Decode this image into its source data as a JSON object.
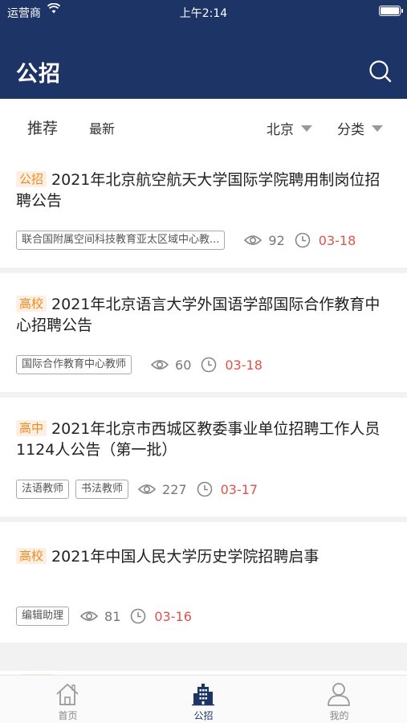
{
  "status_bar": {
    "carrier": "运营商",
    "time": "上午2:14"
  },
  "header": {
    "title": "公招",
    "search_icon": "search-icon"
  },
  "filter": {
    "tabs": [
      {
        "label": "推荐",
        "active": true
      },
      {
        "label": "最新",
        "active": false
      }
    ],
    "region": "北京",
    "category": "分类"
  },
  "cards": [
    {
      "badge": "公招",
      "title": "2021年北京航空航天大学国际学院聘用制岗位招聘公告",
      "tags": [
        "联合国附属空间科技教育亚太区域中心教..."
      ],
      "views": "92",
      "date": "03-18"
    },
    {
      "badge": "高校",
      "title": "2021年北京语言大学外国语学部国际合作教育中心招聘公告",
      "tags": [
        "国际合作教育中心教师"
      ],
      "views": "60",
      "date": "03-18"
    },
    {
      "badge": "高中",
      "title": "2021年北京市西城区教委事业单位招聘工作人员1124人公告（第一批）",
      "tags": [
        "法语教师",
        "书法教师"
      ],
      "views": "227",
      "date": "03-17"
    },
    {
      "badge": "高校",
      "title": "2021年中国人民大学历史学院招聘启事",
      "tags": [
        "编辑助理"
      ],
      "views": "81",
      "date": "03-16"
    }
  ],
  "tab_bar": {
    "items": [
      {
        "label": "首页",
        "icon": "home-icon",
        "active": false
      },
      {
        "label": "公招",
        "icon": "building-icon",
        "active": true
      },
      {
        "label": "我的",
        "icon": "user-icon",
        "active": false
      }
    ]
  },
  "colors": {
    "header_bg": "#1d3466",
    "badge_text": "#f08a24",
    "date_text": "#e0524a"
  }
}
